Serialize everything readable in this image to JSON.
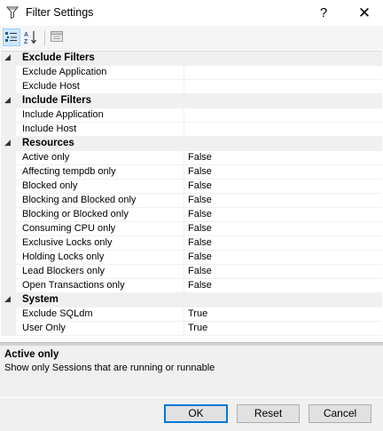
{
  "window": {
    "title": "Filter Settings",
    "help_glyph": "?",
    "close_glyph": "✕"
  },
  "toolbar": {
    "buttons": [
      {
        "name": "categorized-icon",
        "selected": true
      },
      {
        "name": "alphabetical-icon",
        "selected": false
      },
      {
        "name": "property-pages-icon",
        "selected": false
      }
    ]
  },
  "grid": {
    "exclude": {
      "label": "Exclude Filters",
      "items": [
        {
          "name": "Exclude Application",
          "value": ""
        },
        {
          "name": "Exclude Host",
          "value": ""
        }
      ]
    },
    "include": {
      "label": "Include Filters",
      "items": [
        {
          "name": "Include Application",
          "value": ""
        },
        {
          "name": "Include Host",
          "value": ""
        }
      ]
    },
    "resources": {
      "label": "Resources",
      "items": [
        {
          "name": "Active only",
          "value": "False"
        },
        {
          "name": "Affecting tempdb only",
          "value": "False"
        },
        {
          "name": "Blocked only",
          "value": "False"
        },
        {
          "name": "Blocking and Blocked only",
          "value": "False"
        },
        {
          "name": "Blocking or Blocked only",
          "value": "False"
        },
        {
          "name": "Consuming CPU only",
          "value": "False"
        },
        {
          "name": "Exclusive Locks only",
          "value": "False"
        },
        {
          "name": "Holding Locks only",
          "value": "False"
        },
        {
          "name": "Lead Blockers only",
          "value": "False"
        },
        {
          "name": "Open Transactions only",
          "value": "False"
        }
      ]
    },
    "system": {
      "label": "System",
      "items": [
        {
          "name": "Exclude SQLdm",
          "value": "True"
        },
        {
          "name": "User Only",
          "value": "True"
        }
      ]
    }
  },
  "description": {
    "title": "Active only",
    "text": "Show only Sessions that are running or runnable"
  },
  "buttons": {
    "ok": "OK",
    "reset": "Reset",
    "cancel": "Cancel"
  },
  "colors": {
    "accent": "#0078d7",
    "selected_tool": "#cce8ff",
    "category_bg": "#f0f0f0"
  }
}
